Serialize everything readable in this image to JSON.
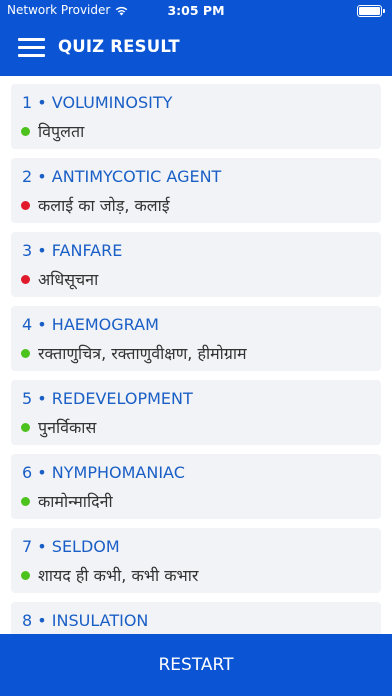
{
  "status_bar": {
    "carrier": "Network Provider",
    "time": "3:05 PM"
  },
  "header": {
    "title": "QUIZ RESULT",
    "menu_icon": "hamburger-menu-icon"
  },
  "results": [
    {
      "title": "1 • VOLUMINOSITY",
      "answer": "विपुलता",
      "status": "correct"
    },
    {
      "title": "2 • ANTIMYCOTIC AGENT",
      "answer": "कलाई का जोड़, कलाई",
      "status": "wrong"
    },
    {
      "title": "3 • FANFARE",
      "answer": "अधिसूचना",
      "status": "wrong"
    },
    {
      "title": "4 • HAEMOGRAM",
      "answer": "रक्ताणुचित्र, रक्ताणुवीक्षण, हीमोग्राम",
      "status": "correct"
    },
    {
      "title": "5 • REDEVELOPMENT",
      "answer": "पुनर्विकास",
      "status": "correct"
    },
    {
      "title": "6 • NYMPHOMANIAC",
      "answer": "कामोन्मादिनी",
      "status": "correct"
    },
    {
      "title": "7 • SELDOM",
      "answer": "शायद ही कभी, कभी कभार",
      "status": "correct"
    },
    {
      "title": "8 • INSULATION",
      "answer": "",
      "status": "correct"
    }
  ],
  "status_colors": {
    "correct": "#4cc21d",
    "wrong": "#e0192b"
  },
  "footer": {
    "restart_label": "RESTART"
  },
  "theme": {
    "primary": "#0b55d4",
    "card_bg": "#f2f3f7",
    "title_color": "#1a5fc6"
  }
}
